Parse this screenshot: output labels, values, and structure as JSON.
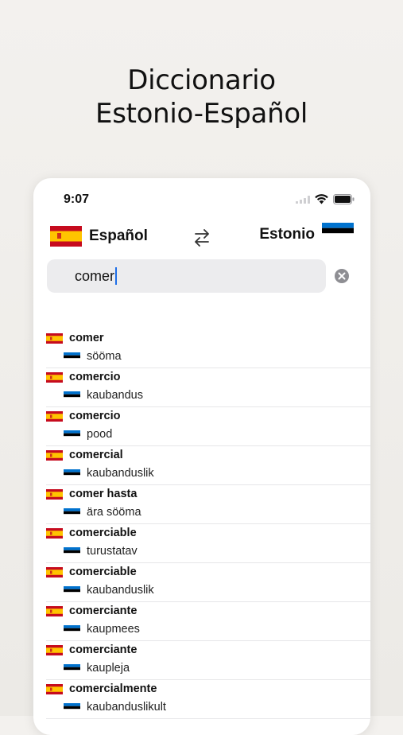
{
  "hero": {
    "line1": "Diccionario",
    "line2": "Estonio-Español"
  },
  "status_bar": {
    "time": "9:07"
  },
  "languages": {
    "source": "Español",
    "target": "Estonio"
  },
  "search": {
    "query": "comer",
    "placeholder": ""
  },
  "colors": {
    "accent": "#1e6ee8",
    "es_red": "#c60b1e",
    "es_yellow": "#ffc400",
    "ee_blue": "#0072ce"
  },
  "results": [
    {
      "es": "comer",
      "et": "sööma"
    },
    {
      "es": "comercio",
      "et": "kaubandus"
    },
    {
      "es": "comercio",
      "et": "pood"
    },
    {
      "es": "comercial",
      "et": "kaubanduslik"
    },
    {
      "es": "comer hasta",
      "et": "ära sööma"
    },
    {
      "es": "comerciable",
      "et": "turustatav"
    },
    {
      "es": "comerciable",
      "et": "kaubanduslik"
    },
    {
      "es": "comerciante",
      "et": "kaupmees"
    },
    {
      "es": "comerciante",
      "et": "kaupleja"
    },
    {
      "es": "comercialmente",
      "et": "kaubanduslikult"
    }
  ]
}
